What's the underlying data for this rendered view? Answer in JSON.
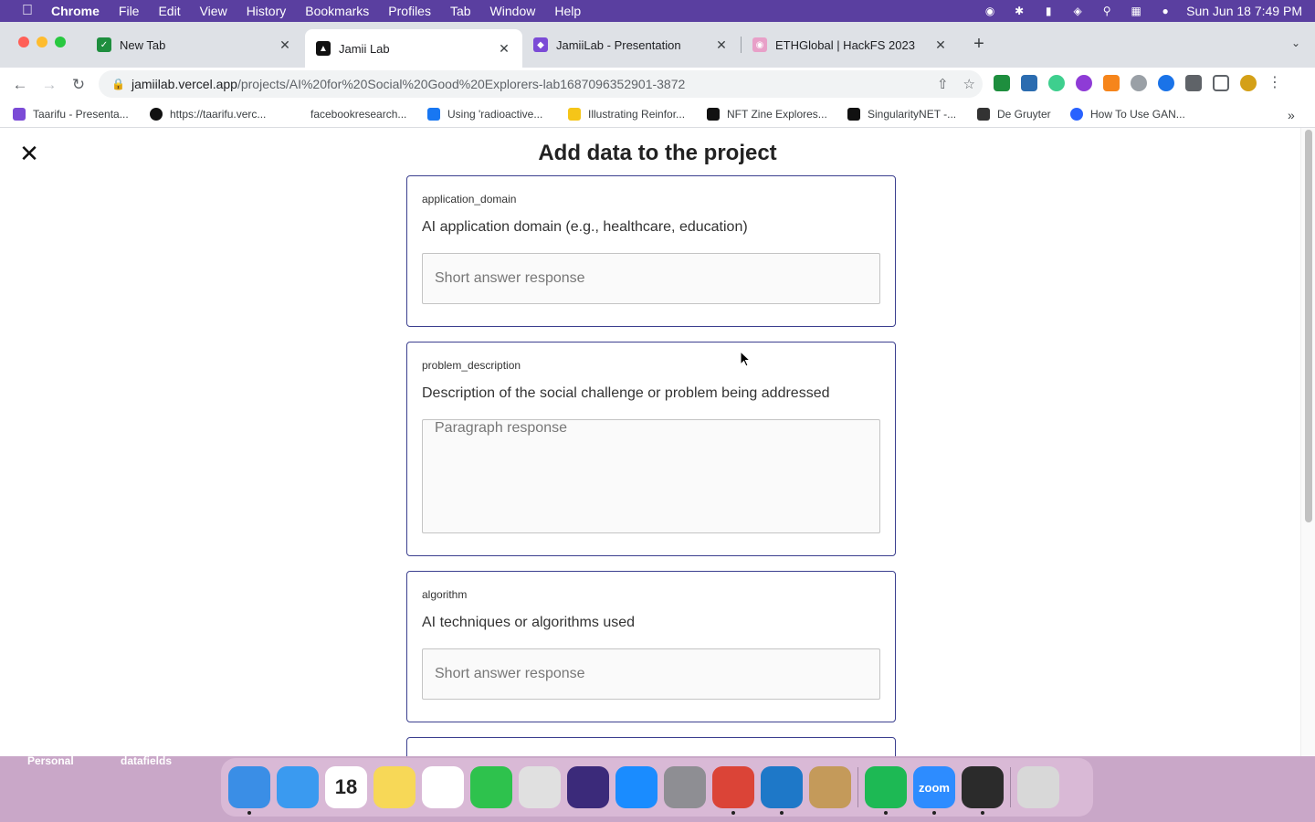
{
  "menubar": {
    "app": "Chrome",
    "items": [
      "File",
      "Edit",
      "View",
      "History",
      "Bookmarks",
      "Profiles",
      "Tab",
      "Window",
      "Help"
    ],
    "clock": "Sun Jun 18  7:49 PM"
  },
  "tabs": [
    {
      "title": "New Tab",
      "color": "#1e8e3e",
      "glyph": "✓"
    },
    {
      "title": "Jamii Lab",
      "color": "#111111",
      "glyph": "▲"
    },
    {
      "title": "JamiiLab - Presentation",
      "color": "#7b4bd6",
      "glyph": "◆"
    },
    {
      "title": "ETHGlobal | HackFS 2023",
      "color": "#e8a0c8",
      "glyph": "◉"
    }
  ],
  "address": {
    "host": "jamiilab.vercel.app",
    "path": "/projects/AI%20for%20Social%20Good%20Explorers-lab1687096352901-3872"
  },
  "bookmarks": [
    {
      "label": "Taarifu - Presenta...",
      "color": "#7b4bd6"
    },
    {
      "label": "https://taarifu.verc...",
      "color": "#111111"
    },
    {
      "label": "facebookresearch...",
      "color": "#ffffff"
    },
    {
      "label": "Using 'radioactive...",
      "color": "#1877f2"
    },
    {
      "label": "Illustrating Reinfor...",
      "color": "#f5c518"
    },
    {
      "label": "NFT Zine Explores...",
      "color": "#111111"
    },
    {
      "label": "SingularityNET -...",
      "color": "#111111"
    },
    {
      "label": "De Gruyter",
      "color": "#333333"
    },
    {
      "label": "How To Use GAN...",
      "color": "#2962ff"
    }
  ],
  "page": {
    "title": "Add data to the project",
    "fields": [
      {
        "key": "application_domain",
        "label": "AI application domain (e.g., healthcare, education)",
        "type": "short",
        "placeholder": "Short answer response"
      },
      {
        "key": "problem_description",
        "label": "Description of the social challenge or problem being addressed",
        "type": "paragraph",
        "placeholder": "Paragraph response"
      },
      {
        "key": "algorithm",
        "label": "AI techniques or algorithms used",
        "type": "short",
        "placeholder": "Short answer response"
      }
    ]
  },
  "desktop": {
    "labels": [
      "Personal",
      "datafields"
    ]
  },
  "dock": [
    {
      "name": "finder",
      "color": "#3a8ee6",
      "dot": true
    },
    {
      "name": "mail",
      "color": "#3a9af0",
      "dot": false
    },
    {
      "name": "calendar",
      "color": "#ffffff",
      "glyph": "18",
      "dot": false
    },
    {
      "name": "notes",
      "color": "#f7d857",
      "dot": false
    },
    {
      "name": "reminders",
      "color": "#ffffff",
      "dot": false
    },
    {
      "name": "facetime",
      "color": "#2ec24d",
      "dot": false
    },
    {
      "name": "launchpad",
      "color": "#e0e0e0",
      "dot": false
    },
    {
      "name": "siri",
      "color": "#3b2a7a",
      "dot": false
    },
    {
      "name": "app-store",
      "color": "#1a8cff",
      "dot": false
    },
    {
      "name": "system-preferences",
      "color": "#8e8e93",
      "dot": false
    },
    {
      "name": "chrome",
      "color": "#db4437",
      "dot": true
    },
    {
      "name": "vscode",
      "color": "#1e78c8",
      "dot": true
    },
    {
      "name": "contacts",
      "color": "#c49a5a",
      "dot": false
    },
    {
      "name": "spotify",
      "color": "#1db954",
      "dot": true
    },
    {
      "name": "zoom",
      "color": "#2d8cff",
      "glyph": "zoom",
      "dot": true
    },
    {
      "name": "quicktime",
      "color": "#2b2b2b",
      "dot": true
    },
    {
      "name": "trash",
      "color": "#d8d8d8",
      "dot": false
    }
  ]
}
